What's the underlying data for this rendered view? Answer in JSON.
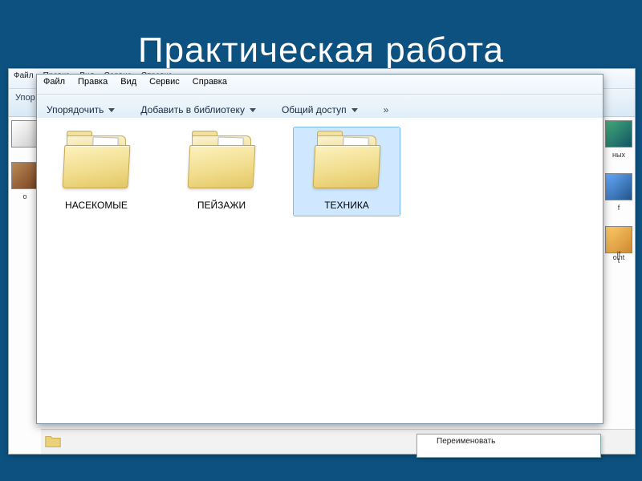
{
  "title": "Практическая работа",
  "bg": {
    "menu": [
      "Файл",
      "Правка",
      "Вид",
      "Сервис",
      "Справка"
    ],
    "toolbar_organize": "Упор",
    "side_labels": {
      "left_o": "о"
    },
    "right_labels": [
      "ных",
      "f",
      "t",
      "oint",
      "if"
    ],
    "context_item": "Переименовать"
  },
  "fg": {
    "menu": {
      "file": "Файл",
      "edit": "Правка",
      "view": "Вид",
      "tools": "Сервис",
      "help": "Справка"
    },
    "toolbar": {
      "organize": "Упорядочить",
      "add_library": "Добавить в библиотеку",
      "share": "Общий доступ",
      "more": "»"
    },
    "folders": [
      {
        "name": "НАСЕКОМЫЕ",
        "selected": false
      },
      {
        "name": "ПЕЙЗАЖИ",
        "selected": false
      },
      {
        "name": "ТЕХНИКА",
        "selected": true
      }
    ]
  }
}
